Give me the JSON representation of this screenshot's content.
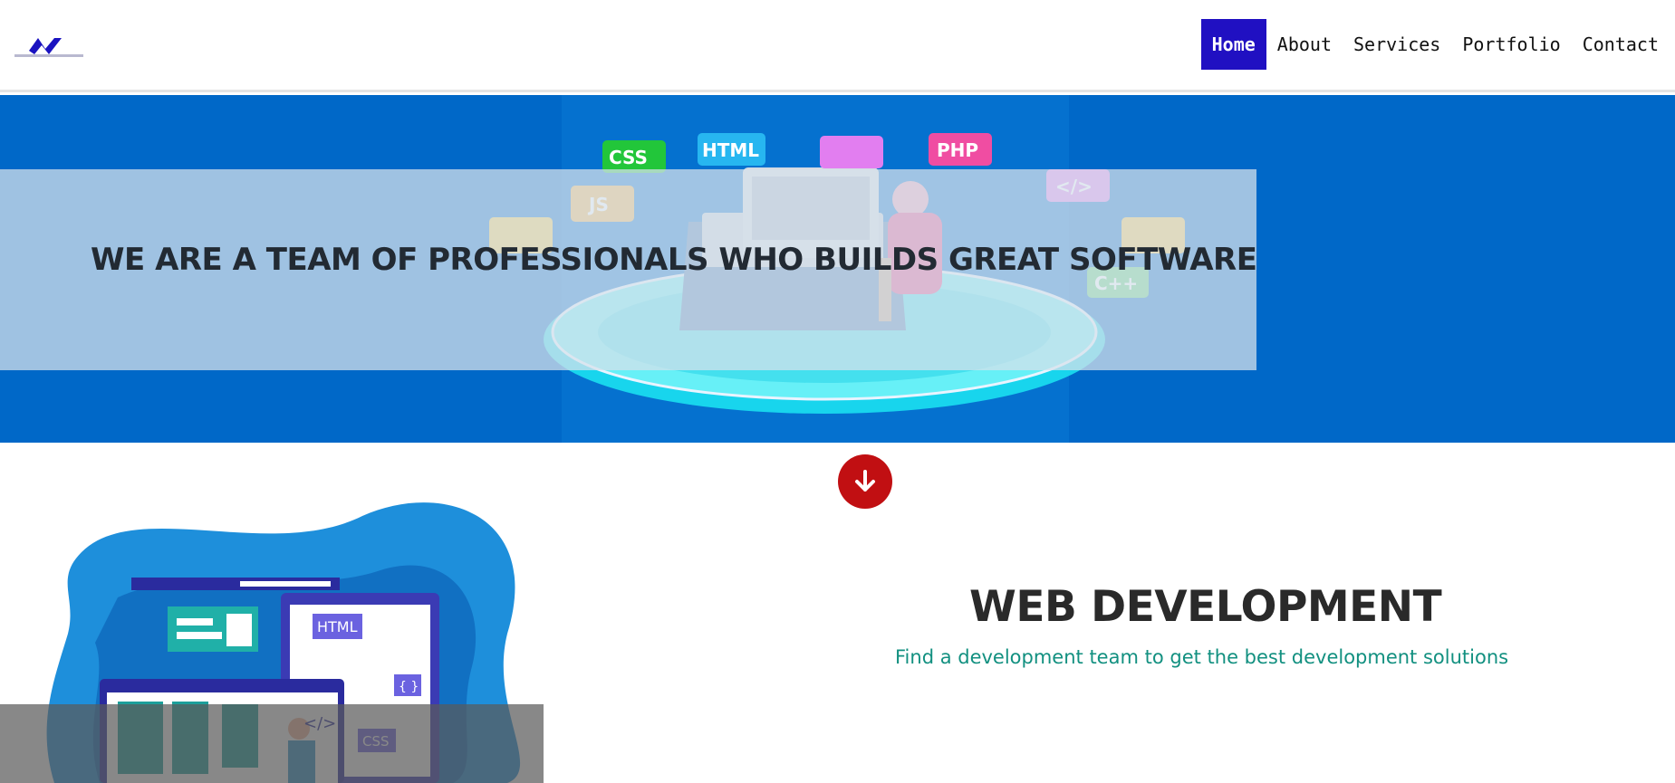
{
  "header": {
    "logo_icon": "brand-logo",
    "nav": [
      {
        "label": "Home",
        "active": true
      },
      {
        "label": "About",
        "active": false
      },
      {
        "label": "Services",
        "active": false
      },
      {
        "label": "Portfolio",
        "active": false
      },
      {
        "label": "Contact",
        "active": false
      }
    ]
  },
  "hero": {
    "title": "WE ARE A TEAM OF PROFESSIONALS WHO BUILDS GREAT SOFTWARE",
    "illustration_badges": [
      "CSS",
      "HTML",
      "PHP",
      "JS",
      "</>",
      "{ }",
      "C++"
    ]
  },
  "scroll_button": {
    "icon": "arrow-down-icon"
  },
  "webdev": {
    "title": "WEB DEVELOPMENT",
    "subtitle": "Find a development team to get the best development solutions",
    "illustration_badges": [
      "HTML",
      "{ }",
      "CSS",
      "</>"
    ]
  },
  "colors": {
    "nav_active_bg": "#2010c2",
    "hero_bg": "#0068c8",
    "scroll_button": "#c10f12",
    "subtitle": "#129080"
  }
}
